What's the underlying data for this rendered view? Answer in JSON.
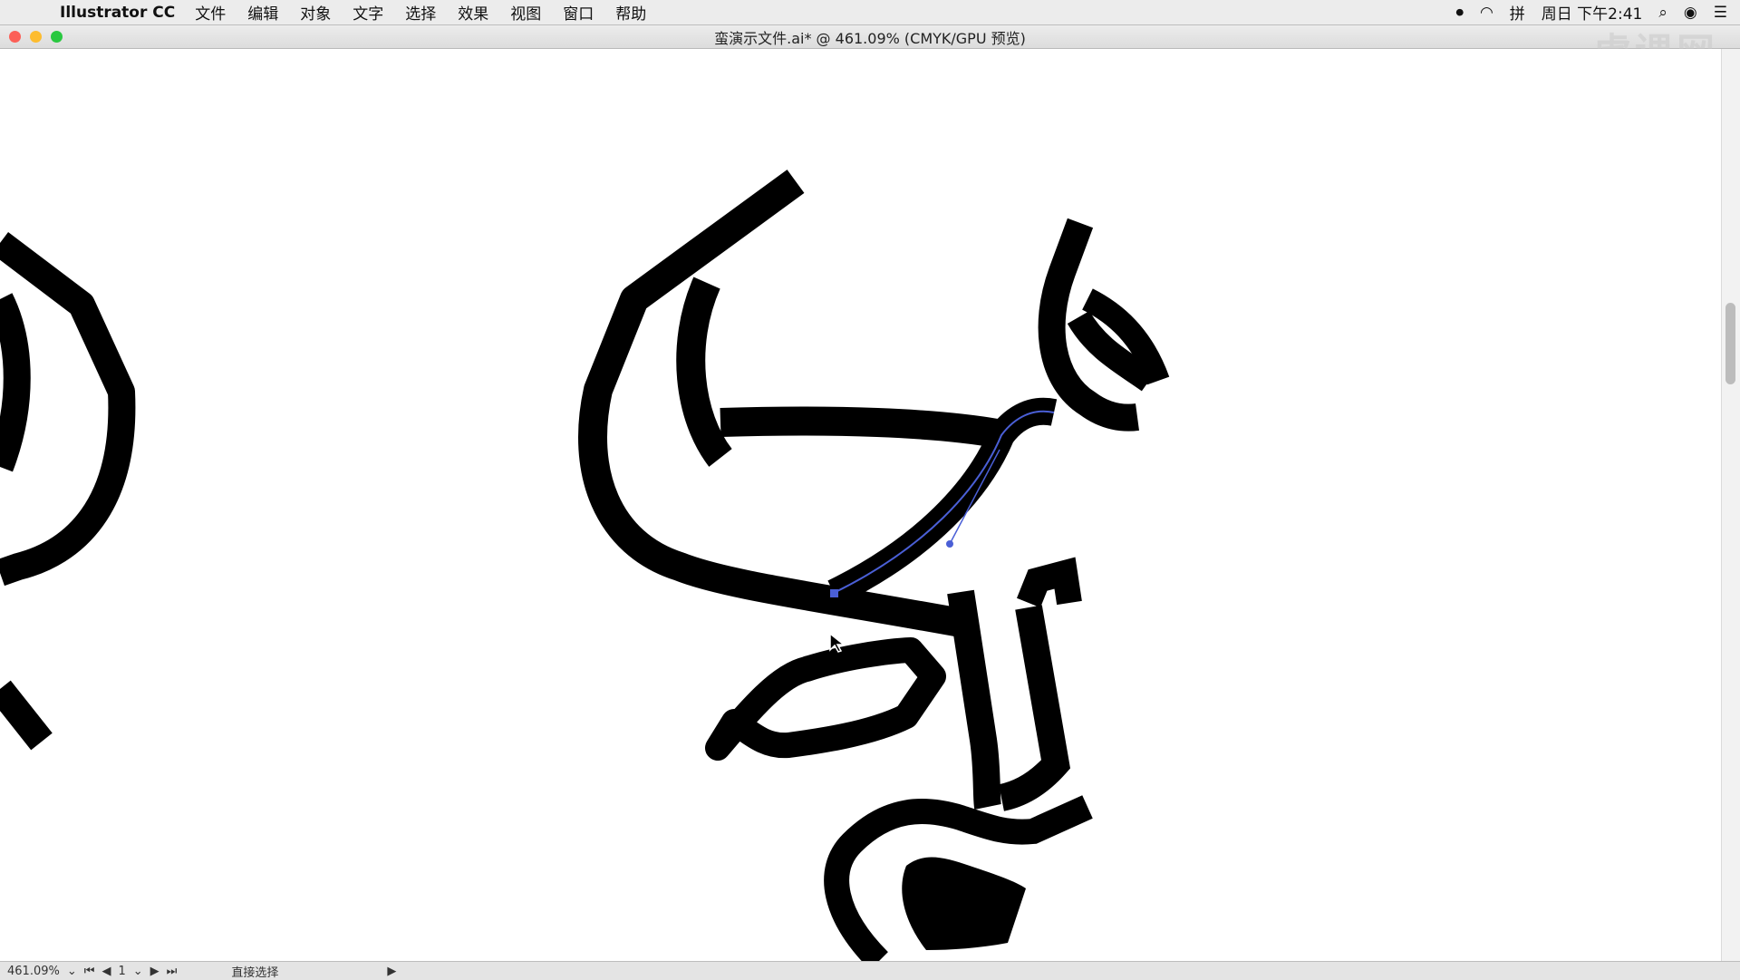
{
  "menubar": {
    "app_name": "Illustrator CC",
    "menus": [
      "文件",
      "编辑",
      "对象",
      "文字",
      "选择",
      "效果",
      "视图",
      "窗口",
      "帮助"
    ],
    "clock": "周日 下午2:41",
    "input_method": "拼"
  },
  "window": {
    "title": "蛮演示文件.ai* @ 461.09% (CMYK/GPU 预览)"
  },
  "statusbar": {
    "zoom": "461.09%",
    "artboard": "1",
    "tool": "直接选择"
  },
  "watermark": "虎课网",
  "colors": {
    "stroke": "#000000",
    "path_highlight": "#4a5fd6",
    "background": "#ffffff"
  }
}
